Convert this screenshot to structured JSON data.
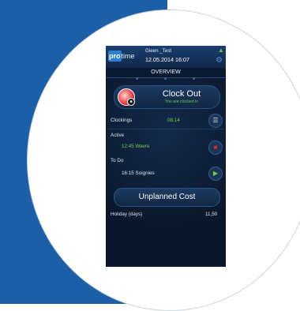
{
  "header": {
    "logo_pro": "pro",
    "logo_time": "time",
    "user": "Gieen _Test",
    "datetime": "12.05.2014 16:07"
  },
  "tab": {
    "title": "OVERVIEW"
  },
  "clock": {
    "title": "Clock Out",
    "subtitle": "You are clocked in"
  },
  "clockings": {
    "label": "Clockings",
    "value": "08:14"
  },
  "active": {
    "label": "Active",
    "item": "12:45 Wavre"
  },
  "todo": {
    "label": "To Do",
    "item": "16:15 Soignies"
  },
  "cost": {
    "label": "Unplanned Cost"
  },
  "holiday": {
    "label": "Holiday (days)",
    "value": "11,50"
  },
  "colors": {
    "brand_blue": "#1d5fa6",
    "accent_green": "#6fcf48",
    "stop_red": "#e0252c"
  }
}
